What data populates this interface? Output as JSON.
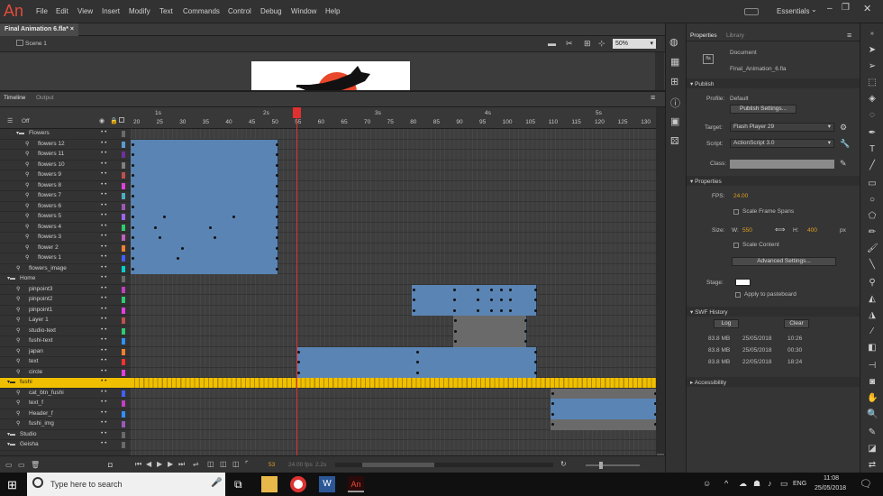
{
  "app": {
    "logo": "An",
    "menus": [
      "File",
      "Edit",
      "View",
      "Insert",
      "Modify",
      "Text",
      "Commands",
      "Control",
      "Debug",
      "Window",
      "Help"
    ],
    "workspace": "Essentials",
    "workspace_arrow": "⌄"
  },
  "document": {
    "tab": "Final Animation 6.fla*",
    "scene": "Scene 1",
    "zoom": "50%"
  },
  "timeline": {
    "tab_timeline": "Timeline",
    "tab_output": "Output",
    "off_label": "Off",
    "seconds": [
      "1s",
      "2s",
      "3s",
      "4s",
      "5s"
    ],
    "frame_numbers": [
      "20",
      "25",
      "30",
      "35",
      "40",
      "45",
      "50",
      "55",
      "60",
      "65",
      "70",
      "75",
      "80",
      "85",
      "90",
      "95",
      "100",
      "105",
      "110",
      "115",
      "120",
      "125",
      "130"
    ],
    "fps_display": "24.00 fps",
    "time_display": "2.2s",
    "frame_display": "53"
  },
  "layers": [
    {
      "name": "Flowers",
      "type": "folder",
      "indent": 1,
      "color": "#6a6a6a"
    },
    {
      "name": "flowers 12",
      "type": "layer",
      "indent": 2,
      "color": "#5b9bd5"
    },
    {
      "name": "flowers 11",
      "type": "layer",
      "indent": 2,
      "color": "#7030a0"
    },
    {
      "name": "flowers 10",
      "type": "layer",
      "indent": 2,
      "color": "#808080"
    },
    {
      "name": "flowers 9",
      "type": "layer",
      "indent": 2,
      "color": "#c0504d"
    },
    {
      "name": "flowers 8",
      "type": "layer",
      "indent": 2,
      "color": "#e040e0"
    },
    {
      "name": "flowers 7",
      "type": "layer",
      "indent": 2,
      "color": "#4bacc6"
    },
    {
      "name": "flowers 6",
      "type": "layer",
      "indent": 2,
      "color": "#9b59b6"
    },
    {
      "name": "flowers 5",
      "type": "layer",
      "indent": 2,
      "color": "#9e66ff"
    },
    {
      "name": "flowers 4",
      "type": "layer",
      "indent": 2,
      "color": "#2ecc71"
    },
    {
      "name": "flowers 3",
      "type": "layer",
      "indent": 2,
      "color": "#c060c0"
    },
    {
      "name": "flower 2",
      "type": "layer",
      "indent": 2,
      "color": "#f08030"
    },
    {
      "name": "flowers 1",
      "type": "layer",
      "indent": 2,
      "color": "#4060ff"
    },
    {
      "name": "flowers_image",
      "type": "layer",
      "indent": 1,
      "color": "#00d0d0"
    },
    {
      "name": "Home",
      "type": "folder",
      "indent": 0,
      "color": "#6a6a6a"
    },
    {
      "name": "pinpoint3",
      "type": "layer",
      "indent": 1,
      "color": "#c040c0"
    },
    {
      "name": "pinpoint2",
      "type": "layer",
      "indent": 1,
      "color": "#2ecc71"
    },
    {
      "name": "pinpoint1",
      "type": "layer",
      "indent": 1,
      "color": "#e040e0"
    },
    {
      "name": "Layer 1",
      "type": "layer",
      "indent": 1,
      "color": "#c0504d"
    },
    {
      "name": "studio-text",
      "type": "layer",
      "indent": 1,
      "color": "#2ecc71"
    },
    {
      "name": "fushi-text",
      "type": "layer",
      "indent": 1,
      "color": "#3090ff"
    },
    {
      "name": "japan",
      "type": "layer",
      "indent": 1,
      "color": "#f08030"
    },
    {
      "name": "text",
      "type": "layer",
      "indent": 1,
      "color": "#ff3030"
    },
    {
      "name": "circle",
      "type": "layer",
      "indent": 1,
      "color": "#e040e0"
    },
    {
      "name": "fushi",
      "type": "folder",
      "indent": 0,
      "color": "#f0c000",
      "selected": true
    },
    {
      "name": "cat_btn_fushi",
      "type": "layer",
      "indent": 1,
      "color": "#4060ff"
    },
    {
      "name": "text_f",
      "type": "layer",
      "indent": 1,
      "color": "#c040c0"
    },
    {
      "name": "Header_f",
      "type": "layer",
      "indent": 1,
      "color": "#3090ff"
    },
    {
      "name": "fushi_img",
      "type": "layer",
      "indent": 1,
      "color": "#9b59b6"
    },
    {
      "name": "Studio",
      "type": "folder",
      "indent": 0,
      "color": "#6a6a6a"
    },
    {
      "name": "Geisha",
      "type": "folder",
      "indent": 0,
      "color": "#6a6a6a"
    }
  ],
  "properties": {
    "tab_properties": "Properties",
    "tab_library": "Library",
    "doc_label": "Document",
    "doc_name": "Final_Animation_6.fla",
    "publish_section": "Publish",
    "profile_label": "Profile:",
    "profile_value": "Default",
    "publish_settings_btn": "Publish Settings...",
    "target_label": "Target:",
    "target_value": "Flash Player 29",
    "script_label": "Script:",
    "script_value": "ActionScript 3.0",
    "class_label": "Class:",
    "properties_section": "Properties",
    "fps_label": "FPS:",
    "fps_value": "24.00",
    "scale_spans": "Scale Frame Spans",
    "size_label": "Size:",
    "w_label": "W:",
    "w_value": "550",
    "h_label": "H:",
    "h_value": "400",
    "unit": "px",
    "scale_content": "Scale Content",
    "advanced_btn": "Advanced Settings...",
    "stage_label": "Stage:",
    "pasteboard": "Apply to pasteboard",
    "swf_section": "SWF History",
    "log_btn": "Log",
    "clear_btn": "Clear",
    "history": [
      [
        "83.8 MB",
        "25/05/2018",
        "10:26"
      ],
      [
        "83.8 MB",
        "25/05/2018",
        "00:30"
      ],
      [
        "83.8 MB",
        "22/05/2018",
        "18:24"
      ]
    ],
    "accessibility_section": "Accessibility"
  },
  "taskbar": {
    "search_placeholder": "Type here to search",
    "time": "11:08",
    "date": "25/05/2018",
    "lang": "ENG"
  },
  "colors": {
    "tween_blue": "#5a84b3",
    "selected_layer": "#f0c000",
    "playhead": "#e03030",
    "brand": "#e24b3a"
  }
}
